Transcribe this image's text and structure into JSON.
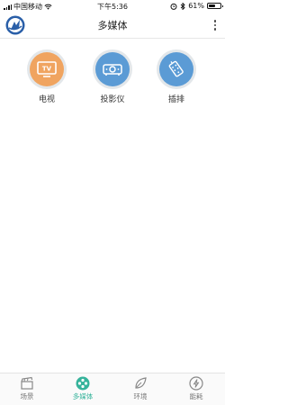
{
  "status_bar": {
    "carrier": "中国移动",
    "time": "下午5:36",
    "battery_text": "61%",
    "battery_level": 0.61
  },
  "header": {
    "title": "多媒体"
  },
  "devices": [
    {
      "label": "电视",
      "icon": "tv-icon",
      "color": "#f0a460",
      "badge": "TV"
    },
    {
      "label": "投影仪",
      "icon": "projector-icon",
      "color": "#5b9bd5"
    },
    {
      "label": "插排",
      "icon": "power-strip-icon",
      "color": "#5b9bd5"
    }
  ],
  "tabs": [
    {
      "label": "场景",
      "icon": "clapperboard-icon",
      "active": false
    },
    {
      "label": "多媒体",
      "icon": "film-reel-icon",
      "active": true
    },
    {
      "label": "环境",
      "icon": "leaf-icon",
      "active": false
    },
    {
      "label": "能耗",
      "icon": "lightning-icon",
      "active": false
    }
  ],
  "colors": {
    "accent": "#36b39b",
    "tv": "#f0a460",
    "blue": "#5b9bd5",
    "ring": "#e3e7ea",
    "inactive_tab": "#777777"
  }
}
